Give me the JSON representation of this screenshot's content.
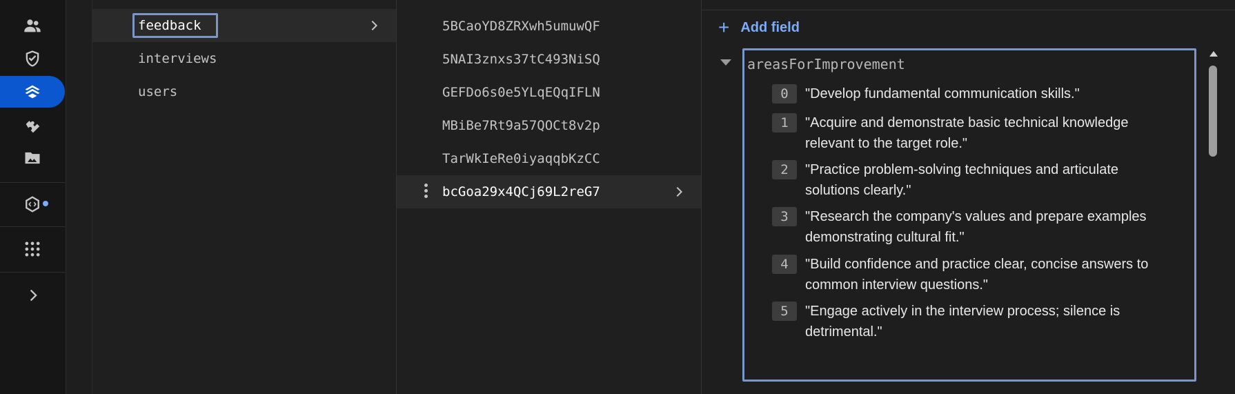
{
  "rail": {
    "icons": [
      "people-icon",
      "shield-check-icon",
      "firestore-icon",
      "extensions-icon",
      "storage-image-icon",
      "genkit-icon",
      "apps-grid-icon",
      "chevron-right-icon"
    ]
  },
  "collections": {
    "items": [
      {
        "label": "feedback",
        "selected": true
      },
      {
        "label": "interviews",
        "selected": false
      },
      {
        "label": "users",
        "selected": false
      }
    ]
  },
  "documents": {
    "items": [
      {
        "label": "5BCaoYD8ZRXwh5umuwQF"
      },
      {
        "label": "5NAI3znxs37tC493NiSQ"
      },
      {
        "label": "GEFDo6s0e5YLqEQqIFLN"
      },
      {
        "label": "MBiBe7Rt9a57QOCt8v2p"
      },
      {
        "label": "TarWkIeRe0iyaqqbKzCC"
      },
      {
        "label": "bcGoa29x4QCj69L2reG7",
        "selected": true
      }
    ]
  },
  "fields": {
    "add_field_label": "Add field",
    "field_name": "areasForImprovement",
    "items": [
      {
        "index": "0",
        "line1": "\"Develop fundamental communication skills.\"",
        "line2": ""
      },
      {
        "index": "1",
        "line1": "\"Acquire and demonstrate basic technical knowledge",
        "line2": "relevant to the target role.\""
      },
      {
        "index": "2",
        "line1": "\"Practice problem-solving techniques and articulate",
        "line2": "solutions clearly.\""
      },
      {
        "index": "3",
        "line1": "\"Research the company's values and prepare examples",
        "line2": "demonstrating cultural fit.\""
      },
      {
        "index": "4",
        "line1": "\"Build confidence and practice clear, concise answers to",
        "line2": "common interview questions.\""
      },
      {
        "index": "5",
        "line1": "\"Engage actively in the interview process; silence is",
        "line2": "detrimental.\""
      }
    ]
  },
  "colors": {
    "accent": "#7cacf8",
    "active_rail": "#0b57d0",
    "focus_border": "#7b96c9"
  }
}
